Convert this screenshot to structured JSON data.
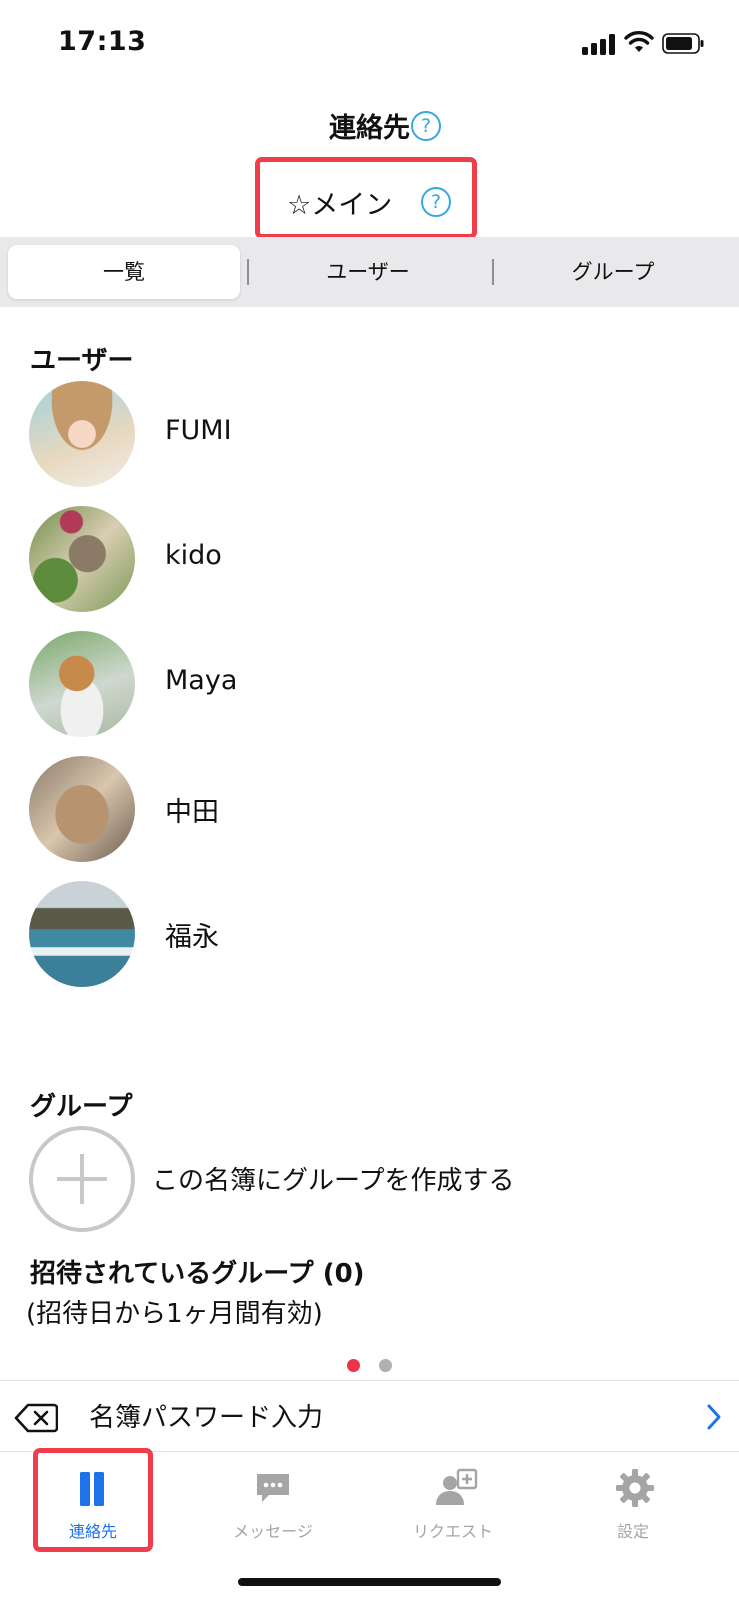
{
  "status_bar": {
    "time": "17:13"
  },
  "header": {
    "title": "連絡先",
    "book_name": "☆メイン",
    "help_symbol": "?"
  },
  "segments": {
    "items": [
      "一覧",
      "ユーザー",
      "グループ"
    ],
    "selected_index": 0
  },
  "users_section": {
    "heading": "ユーザー",
    "users": [
      {
        "name": "FUMI",
        "avatar": "woman-in-straw-hat-photo"
      },
      {
        "name": "kido",
        "avatar": "grilled-fish-dish-photo"
      },
      {
        "name": "Maya",
        "avatar": "pomeranian-dog-photo"
      },
      {
        "name": "中田",
        "avatar": "sleeping-cat-photo"
      },
      {
        "name": "福永",
        "avatar": "lake-landscape-photo"
      }
    ]
  },
  "groups_section": {
    "heading": "グループ",
    "create_label": "この名簿にグループを作成する"
  },
  "invited_section": {
    "heading": "招待されているグループ (0)",
    "note": "(招待日から1ヶ月間有効)"
  },
  "page_indicator": {
    "count": 2,
    "active_index": 0,
    "active_color": "#e9344c",
    "inactive_color": "#b0b0b0"
  },
  "password_bar": {
    "label": "名簿パスワード入力",
    "back_icon": "delete-backspace-icon",
    "chevron_icon": "chevron-right-icon"
  },
  "tab_bar": {
    "tabs": [
      {
        "label": "連絡先",
        "icon": "contacts-book-icon",
        "active": true
      },
      {
        "label": "メッセージ",
        "icon": "chat-bubble-icon",
        "active": false
      },
      {
        "label": "リクエスト",
        "icon": "add-person-request-icon",
        "active": false
      },
      {
        "label": "設定",
        "icon": "gear-icon",
        "active": false
      }
    ],
    "active_color": "#1e73e8",
    "inactive_color": "#a5a5a5"
  },
  "highlight_color": "#ef3e4a"
}
